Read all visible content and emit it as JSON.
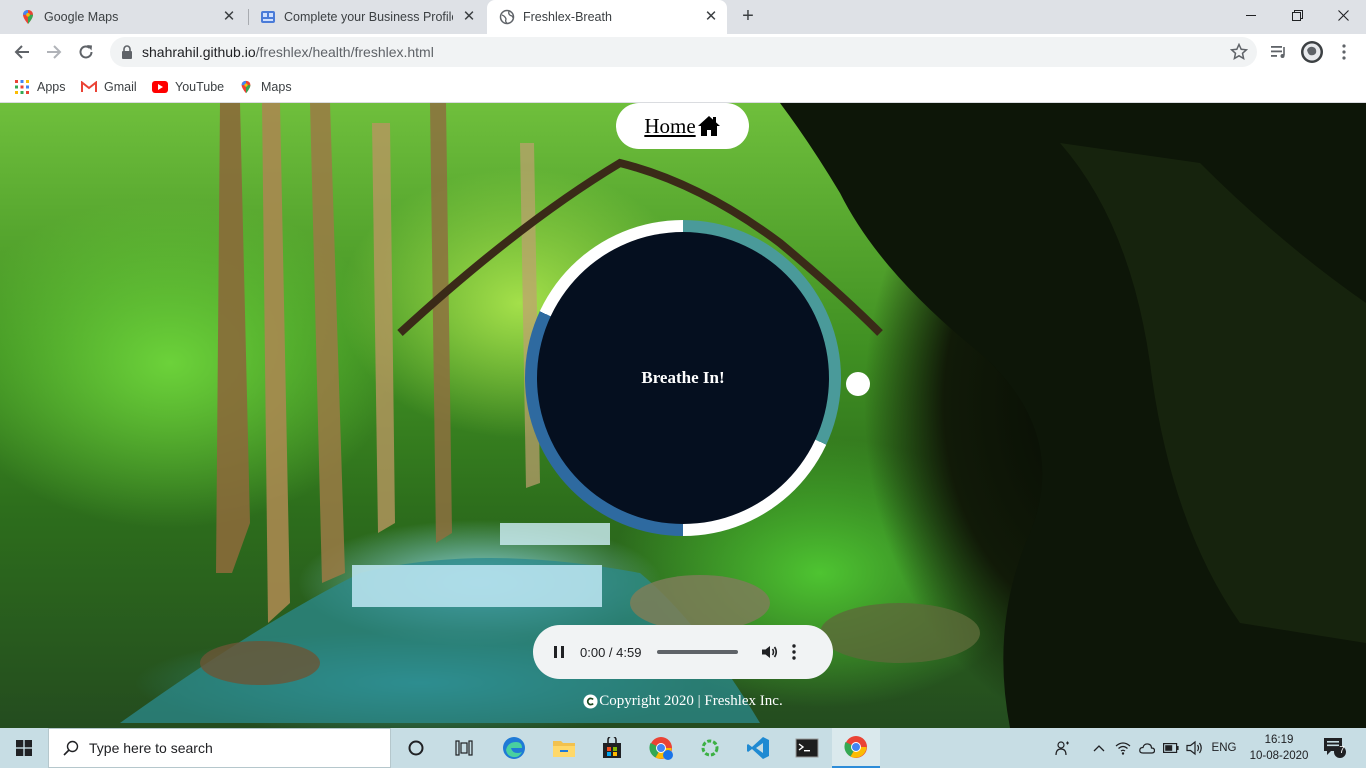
{
  "browser": {
    "tabs": [
      {
        "label": "Google Maps",
        "favicon": "google-maps-icon",
        "active": false
      },
      {
        "label": "Complete your Business Profile |",
        "favicon": "business-profile-icon",
        "active": false
      },
      {
        "label": "Freshlex-Breath",
        "favicon": "globe-icon",
        "active": true
      }
    ],
    "close_glyph": "✕",
    "newtab_glyph": "+",
    "url_host": "shahrahil.github.io",
    "url_path": "/freshlex/health/freshlex.html",
    "bookmarks": [
      "Apps",
      "Gmail",
      "YouTube",
      "Maps"
    ]
  },
  "page": {
    "home_label": "Home",
    "breath_text": "Breathe In!",
    "audio": {
      "current": "0:00",
      "duration": "4:59",
      "time_label": "0:00 / 4:59",
      "progress": 0
    },
    "copyright": "Copyright 2020 | Freshlex Inc.",
    "colors": {
      "ring_teal": "#4a9a9a",
      "ring_blue": "#2e6aa0",
      "ring_white": "#ffffff",
      "core": "#050f1f"
    }
  },
  "taskbar": {
    "search_placeholder": "Type here to search",
    "language": "ENG",
    "time": "16:19",
    "date": "10-08-2020",
    "notifications": "7"
  }
}
